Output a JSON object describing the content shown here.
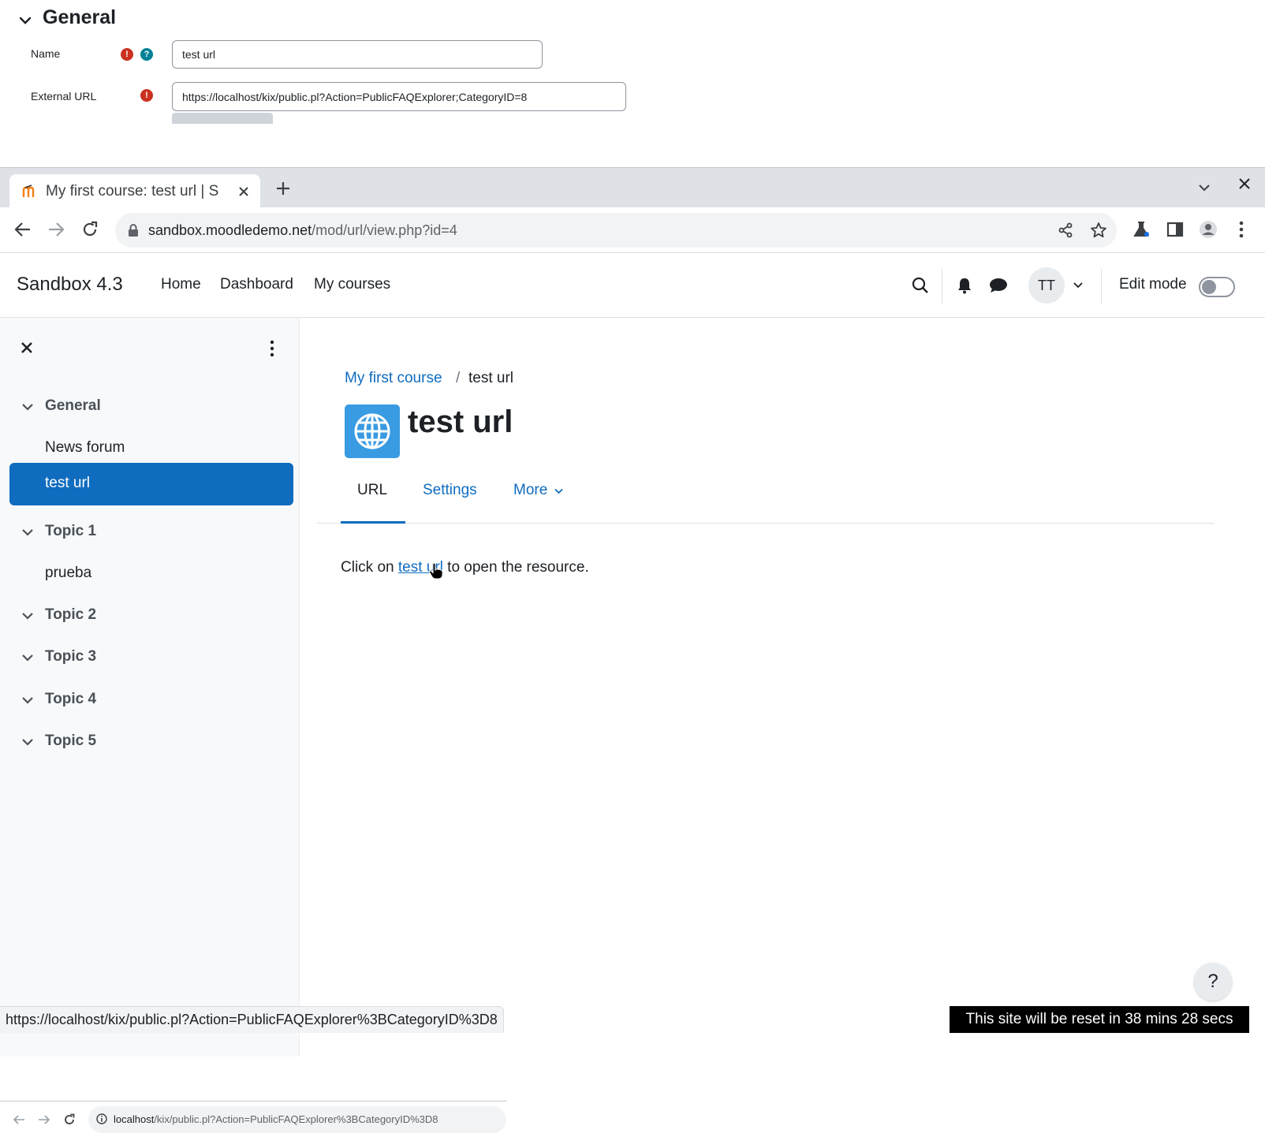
{
  "form": {
    "section_title": "General",
    "name_label": "Name",
    "name_value": "test url",
    "url_label": "External URL",
    "url_value": "https://localhost/kix/public.pl?Action=PublicFAQExplorer;CategoryID=8",
    "required_icon": "exclamation-circle-icon",
    "help_icon": "question-circle-icon"
  },
  "browser": {
    "tab_title": "My first course: test url | S",
    "url_host": "sandbox.moodledemo.net",
    "url_path": "/mod/url/view.php?id=4"
  },
  "navbar": {
    "brand": "Sandbox 4.3",
    "links": [
      "Home",
      "Dashboard",
      "My courses"
    ],
    "avatar_initials": "TT",
    "edit_mode_label": "Edit mode",
    "edit_mode_on": false
  },
  "drawer": {
    "sections": [
      {
        "title": "General",
        "items": [
          "News forum",
          "test url"
        ]
      },
      {
        "title": "Topic 1",
        "items": [
          "prueba"
        ]
      },
      {
        "title": "Topic 2",
        "items": []
      },
      {
        "title": "Topic 3",
        "items": []
      },
      {
        "title": "Topic 4",
        "items": []
      },
      {
        "title": "Topic 5",
        "items": []
      }
    ],
    "active_item": "test url"
  },
  "main": {
    "breadcrumb_course": "My first course",
    "breadcrumb_sep": "/",
    "breadcrumb_current": "test url",
    "title": "test url",
    "tabs": [
      "URL",
      "Settings",
      "More"
    ],
    "active_tab": "URL",
    "resource_prefix": "Click on",
    "resource_link": "test url",
    "resource_suffix": "to open the resource.",
    "help_label": "?"
  },
  "status": {
    "hover_url": "https://localhost/kix/public.pl?Action=PublicFAQExplorer%3BCategoryID%3D8",
    "reset_notice": "This site will be reset in 38 mins 28 secs"
  },
  "bottom_browser": {
    "url_host": "localhost",
    "url_path": "/kix/public.pl?Action=PublicFAQExplorer%3BCategoryID%3D8"
  },
  "colors": {
    "primary": "#0f6cbf",
    "error": "#ca3120",
    "info": "#008196",
    "url_icon": "#399be2"
  }
}
